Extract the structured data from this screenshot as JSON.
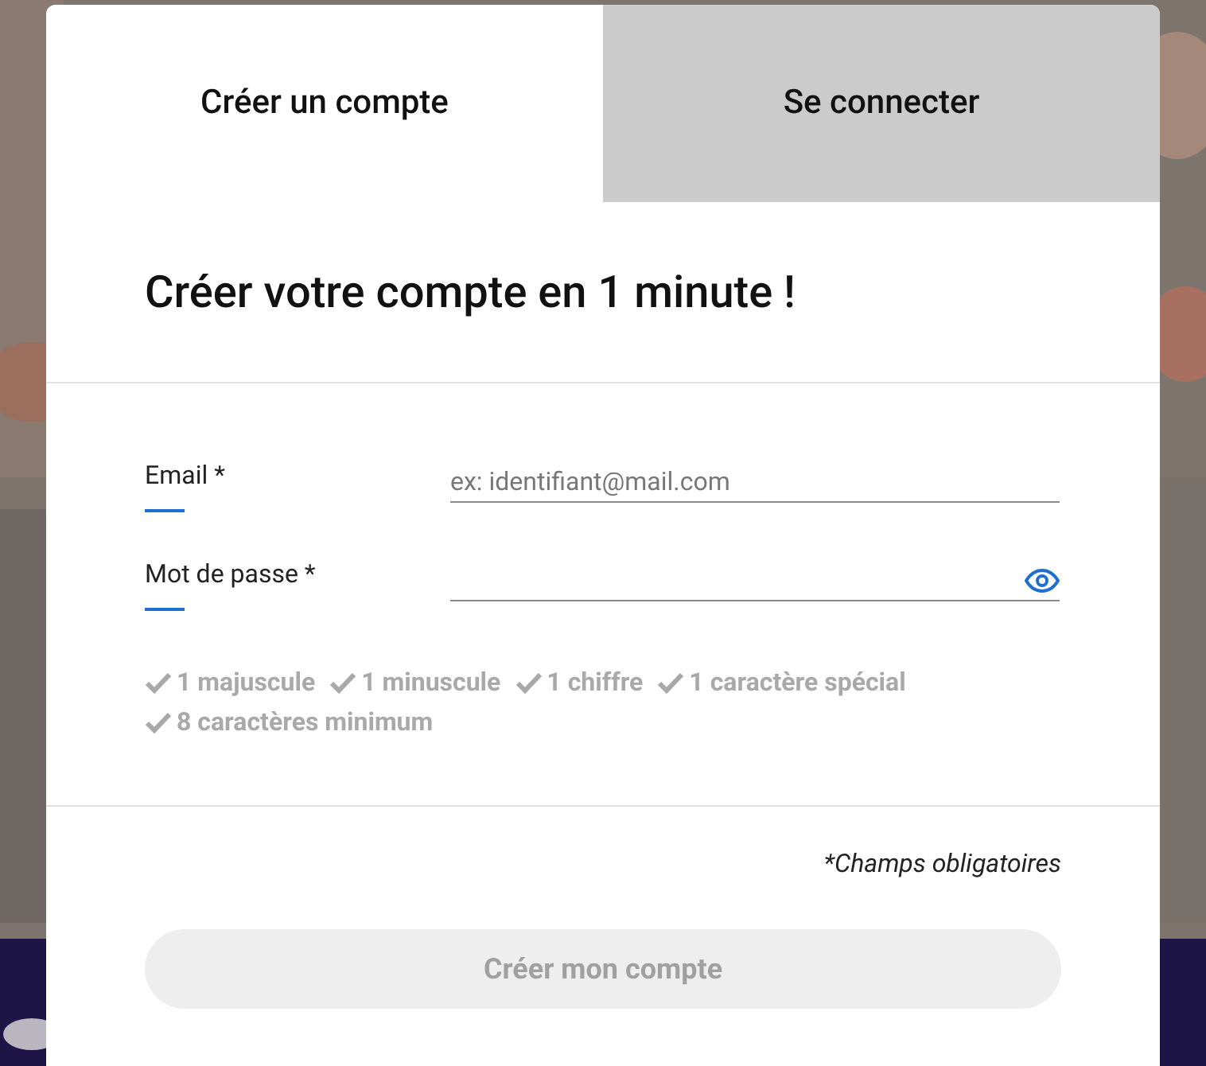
{
  "tabs": [
    {
      "label": "Créer un compte",
      "selected": true
    },
    {
      "label": "Se connecter",
      "selected": false
    }
  ],
  "heading": "Créer votre compte en 1 minute !",
  "fields": [
    {
      "label": "Email *",
      "placeholder": "ex: identifiant@mail.com",
      "kind": "text"
    },
    {
      "label": "Mot de passe *",
      "kind": "password"
    }
  ],
  "password_rules": [
    {
      "text": "1 majuscule",
      "met": false
    },
    {
      "text": "1 minuscule",
      "met": false
    },
    {
      "text": "1 chiffre",
      "met": false
    },
    {
      "text": "1 caractère spécial",
      "met": false
    },
    {
      "text": "8 caractères minimum",
      "met": false
    }
  ],
  "required_note": "*Champs obligatoires",
  "submit": {
    "label": "Créer mon compte",
    "disabled": true
  }
}
